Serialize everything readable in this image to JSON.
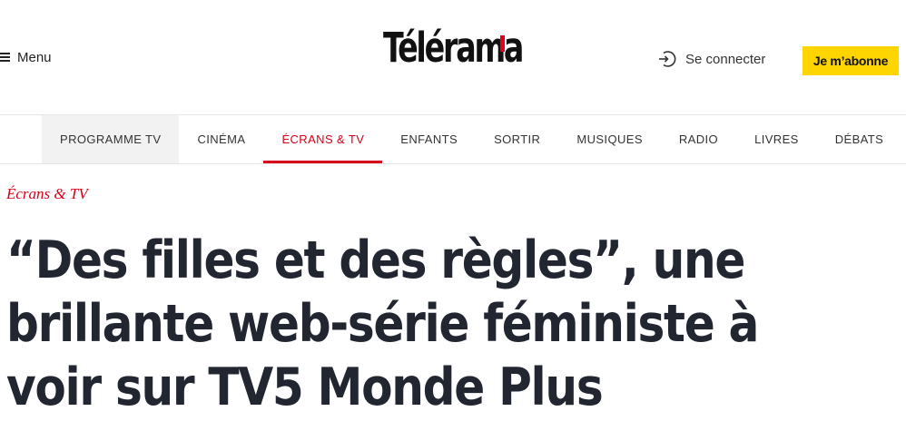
{
  "header": {
    "menu_label": "Menu",
    "logo_text": "Télérama",
    "login_label": "Se connecter",
    "subscribe_label": "Je m’abonne",
    "subscribe_color": "#ffd500",
    "brand_red": "#d80019"
  },
  "nav": {
    "items": [
      {
        "label": "PROGRAMME TV"
      },
      {
        "label": "CINÉMA"
      },
      {
        "label": "ÉCRANS & TV"
      },
      {
        "label": "ENFANTS"
      },
      {
        "label": "SORTIR"
      },
      {
        "label": "MUSIQUES"
      },
      {
        "label": "RADIO"
      },
      {
        "label": "LIVRES"
      },
      {
        "label": "DÉBATS"
      }
    ],
    "active_item": "ÉCRANS & TV",
    "hovered_item": "PROGRAMME TV"
  },
  "article": {
    "category": "Écrans & TV",
    "headline": "“Des filles et des règles”, une brillante web-série féministe à voir sur TV5 Monde Plus"
  },
  "icons": {
    "menu": "hamburger-icon",
    "login": "login-arrow-icon"
  }
}
